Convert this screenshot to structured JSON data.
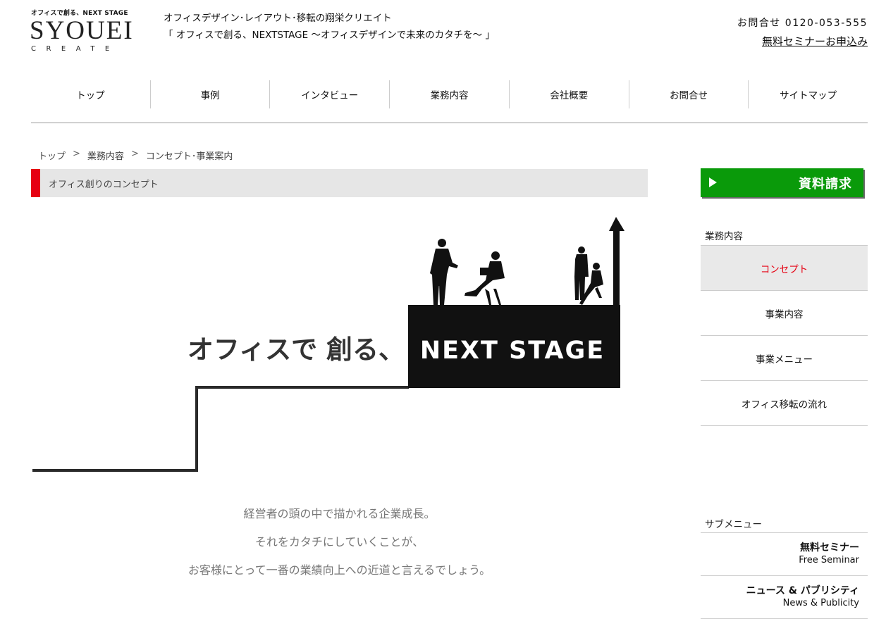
{
  "header": {
    "logo_tagline": "オフィスで創る、NEXT STAGE",
    "logo_main": "SYOUEI",
    "logo_sub": "CREATE",
    "site_desc_1": "オフィスデザイン･レイアウト･移転の翔栄クリエイト",
    "site_desc_2": "「 オフィスで創る、NEXTSTAGE ～オフィスデザインで未来のカタチを～ 」",
    "contact": "お問合せ 0120-053-555",
    "seminar_link": "無料セミナーお申込み"
  },
  "nav": {
    "items": [
      "トップ",
      "事例",
      "インタビュー",
      "業務内容",
      "会社概要",
      "お問合せ",
      "サイトマップ"
    ]
  },
  "breadcrumb": {
    "items": [
      "トップ",
      "業務内容",
      "コンセプト･事業案内"
    ],
    "sep": ">"
  },
  "section_title": "オフィス創りのコンセプト",
  "hero": {
    "headline_jp": "オフィスで 創る、",
    "headline_en": "NEXT STAGE"
  },
  "copy": {
    "line1": "経営者の頭の中で描かれる企業成長。",
    "line2": "それをカタチにしていくことが、",
    "line3": "お客様にとって一番の業績向上への近道と言えるでしょう。"
  },
  "sidebar": {
    "doc_button": "資料請求",
    "section_head": "業務内容",
    "items": [
      "コンセプト",
      "事業内容",
      "事業メニュー",
      "オフィス移転の流れ"
    ],
    "sub_head": "サブメニュー",
    "sub_items": [
      {
        "jp": "無料セミナー",
        "en": "Free Seminar"
      },
      {
        "jp": "ニュース & パブリシティ",
        "en": "News & Publicity"
      }
    ]
  },
  "colors": {
    "accent_red": "#e60012",
    "button_green": "#0a9a0a"
  }
}
